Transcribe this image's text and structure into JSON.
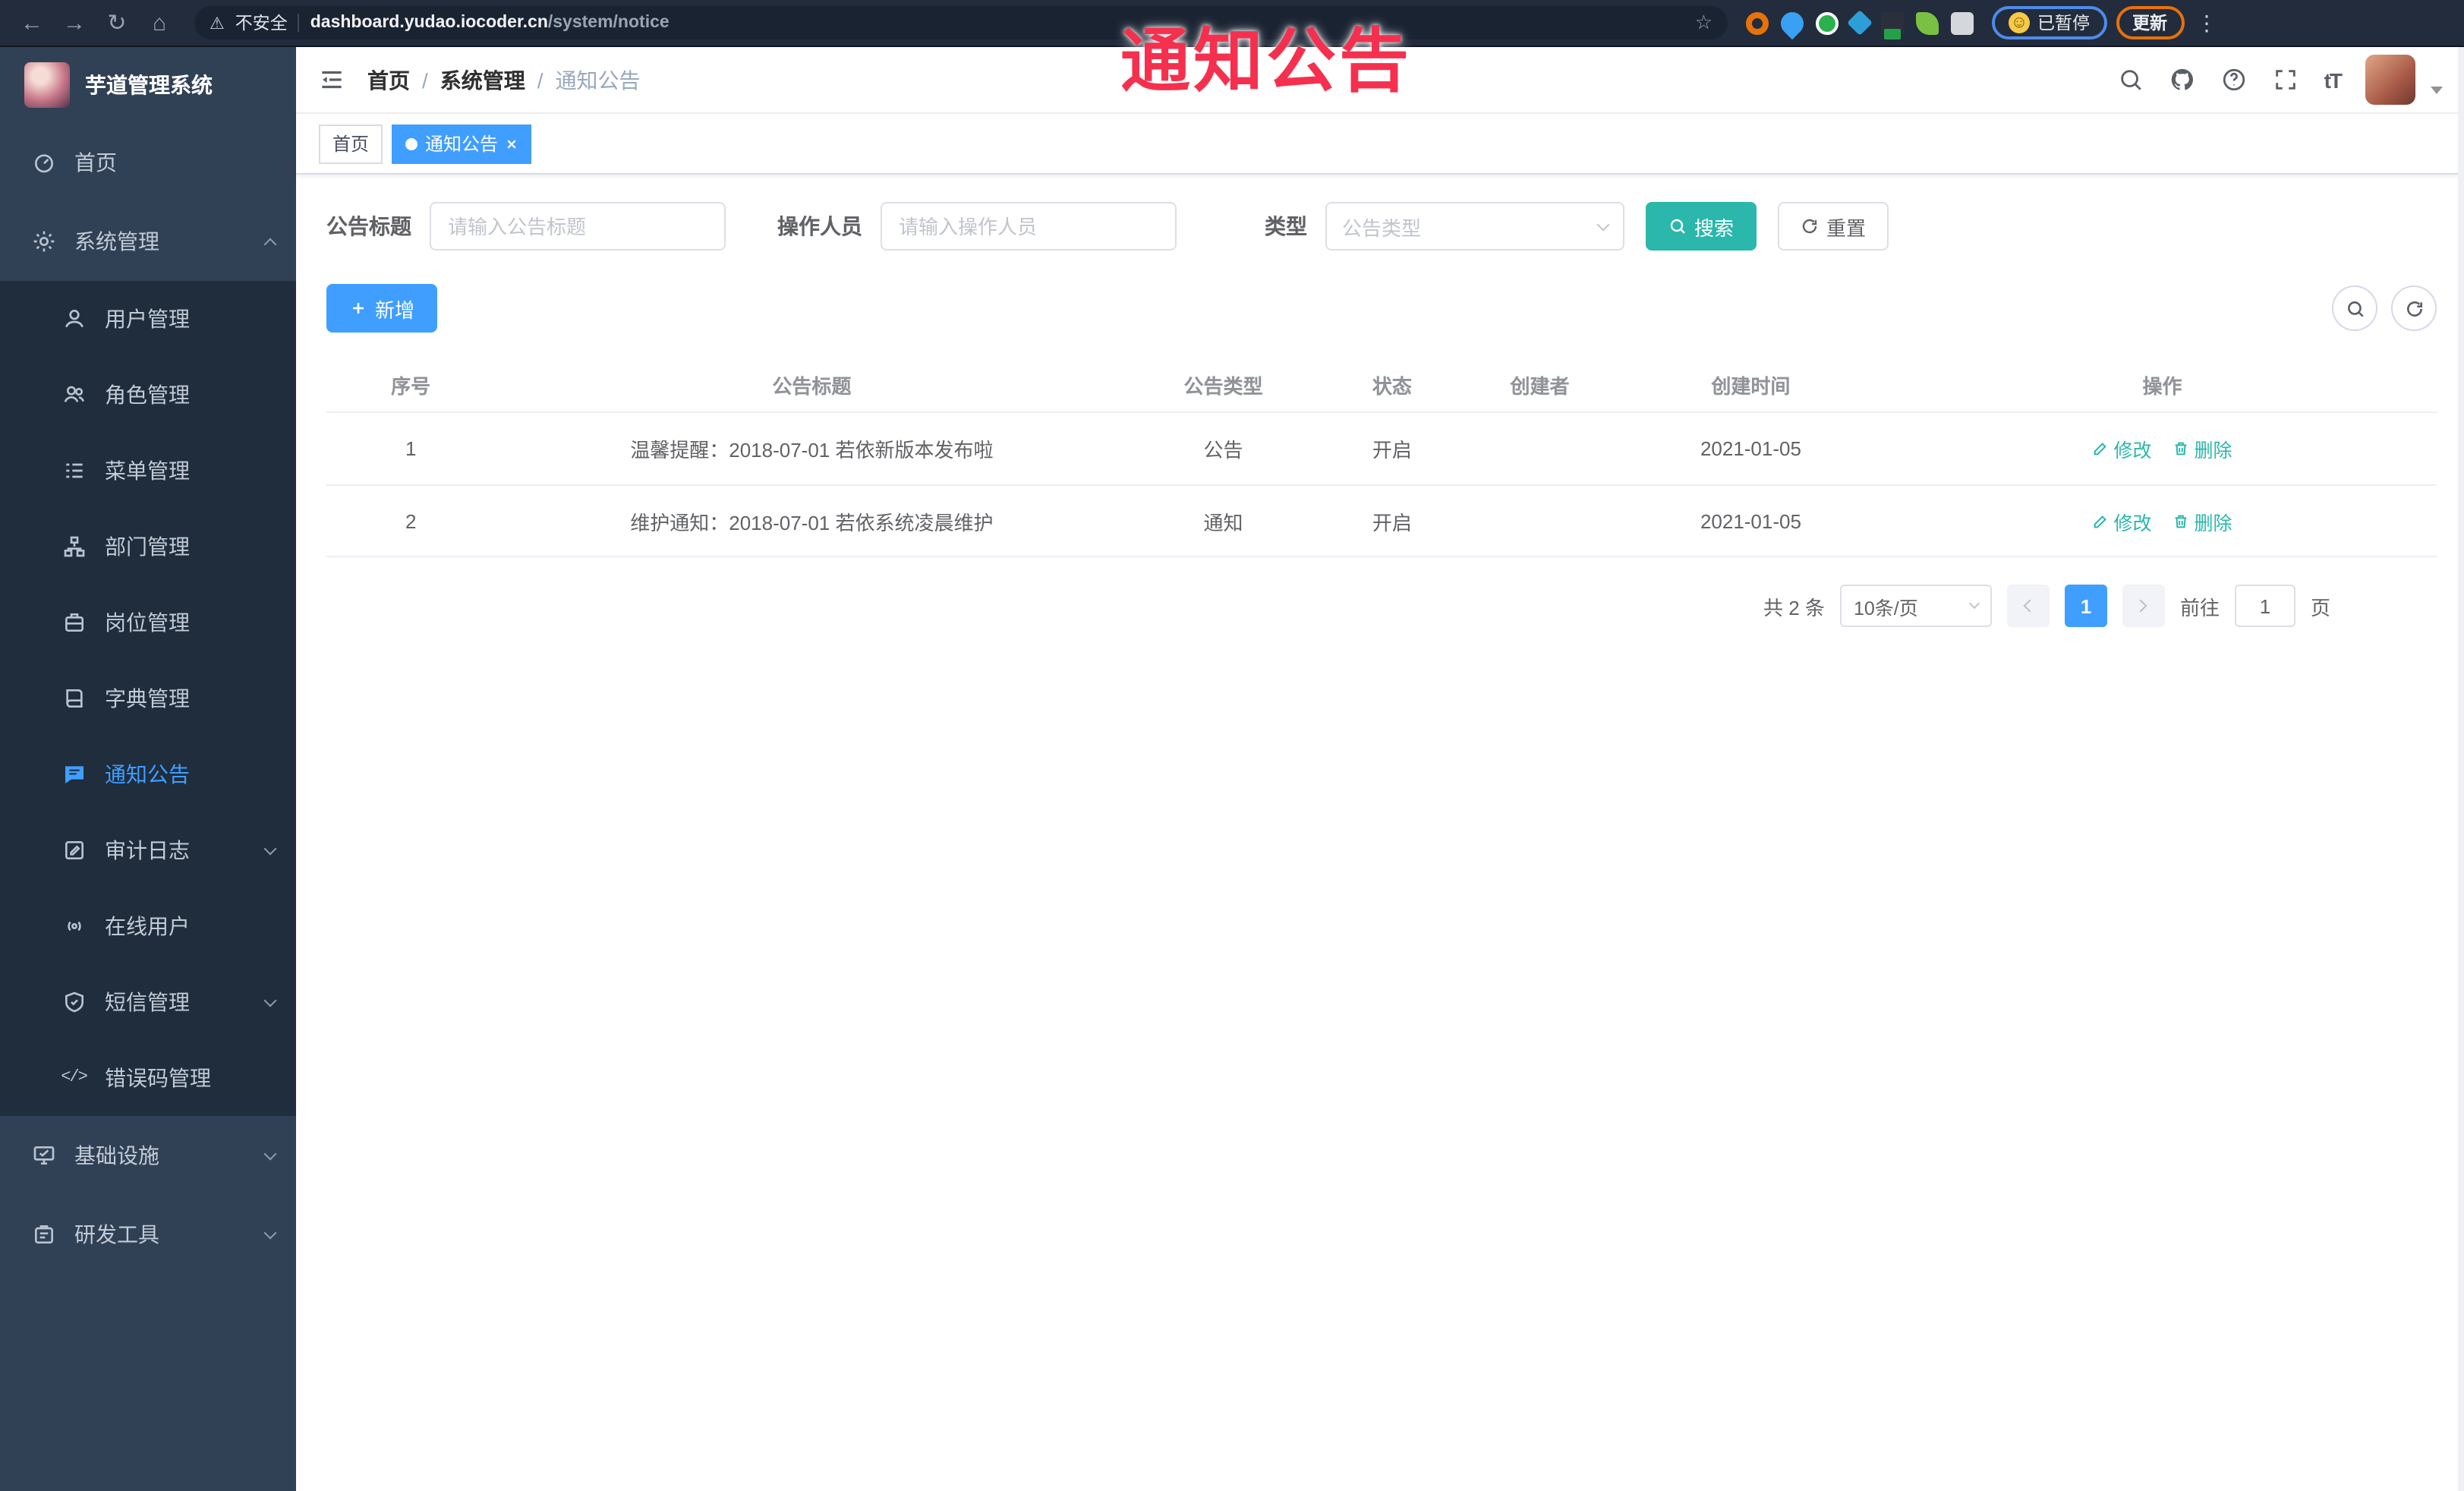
{
  "watermark": {
    "text": "通知公告"
  },
  "browser": {
    "icons": {
      "back": "←",
      "forward": "→",
      "reload": "↻",
      "home": "⌂",
      "star": "☆",
      "warning": "⚠",
      "menu": "⋮",
      "face": "☺"
    },
    "security_label": "不安全",
    "url_host": "dashboard.yudao.iocoder.cn",
    "url_path": "/system/notice",
    "profile_status": "已暂停",
    "update_label": "更新"
  },
  "sidebar": {
    "app_title": "芋道管理系统",
    "items": [
      {
        "label": "首页"
      },
      {
        "label": "系统管理"
      },
      {
        "label": "用户管理"
      },
      {
        "label": "角色管理"
      },
      {
        "label": "菜单管理"
      },
      {
        "label": "部门管理"
      },
      {
        "label": "岗位管理"
      },
      {
        "label": "字典管理"
      },
      {
        "label": "通知公告"
      },
      {
        "label": "审计日志"
      },
      {
        "label": "在线用户"
      },
      {
        "label": "短信管理"
      },
      {
        "label": "错误码管理"
      },
      {
        "label": "基础设施"
      },
      {
        "label": "研发工具"
      }
    ]
  },
  "navbar": {
    "breadcrumb": [
      "首页",
      "系统管理",
      "通知公告"
    ],
    "separator": "/",
    "font_icon_label": "tT"
  },
  "tags": [
    {
      "label": "首页"
    },
    {
      "label": "通知公告"
    }
  ],
  "filters": {
    "title_label": "公告标题",
    "title_placeholder": "请输入公告标题",
    "operator_label": "操作人员",
    "operator_placeholder": "请输入操作人员",
    "type_label": "类型",
    "type_placeholder": "公告类型",
    "search_label": "搜索",
    "reset_label": "重置"
  },
  "toolbar": {
    "add_label": "新增"
  },
  "table": {
    "columns": [
      "序号",
      "公告标题",
      "公告类型",
      "状态",
      "创建者",
      "创建时间",
      "操作"
    ],
    "rows": [
      {
        "index": "1",
        "title": "温馨提醒：2018-07-01 若依新版本发布啦",
        "type": "公告",
        "status": "开启",
        "creator": "",
        "create_time": "2021-01-05"
      },
      {
        "index": "2",
        "title": "维护通知：2018-07-01 若依系统凌晨维护",
        "type": "通知",
        "status": "开启",
        "creator": "",
        "create_time": "2021-01-05"
      }
    ],
    "edit_label": "修改",
    "delete_label": "删除"
  },
  "pagination": {
    "total_text": "共 2 条",
    "page_size": "10条/页",
    "current_page": "1",
    "goto_label": "前往",
    "goto_value": "1",
    "page_unit": "页"
  },
  "colors": {
    "accent_blue": "#409EFF",
    "accent_teal": "#2BB7AB",
    "sidebar_bg": "#304156",
    "submenu_bg": "#1F2D3D",
    "watermark_red": "#F5304E"
  }
}
